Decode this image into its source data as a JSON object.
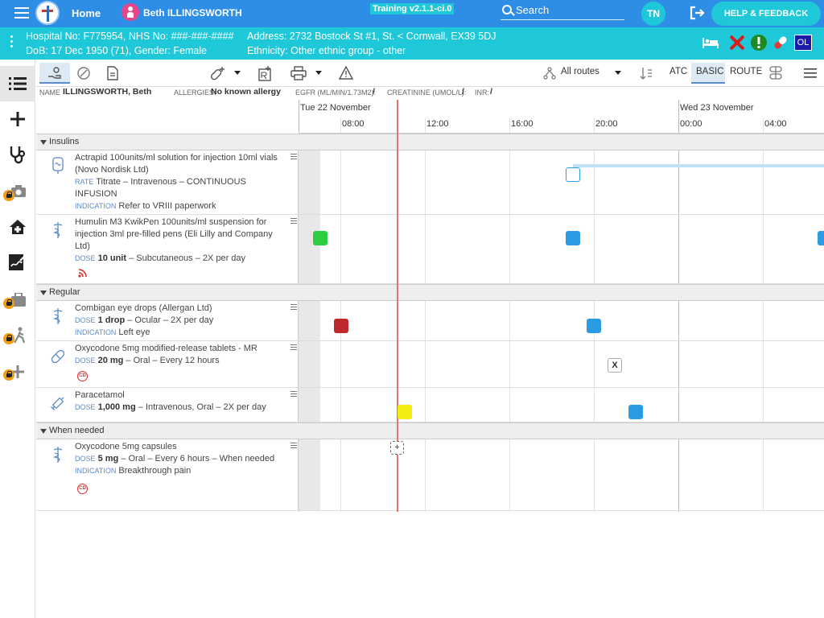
{
  "topbar": {
    "home_label": "Home",
    "patient_name": "Beth ILLINGSWORTH",
    "training_badge": "Training v2.1.1-ci.0",
    "search_label": "Search",
    "user_initials": "TN",
    "help_label": "HELP & FEEDBACK"
  },
  "patient": {
    "hospital_line": "Hospital No: F775954, NHS No: ###-###-####",
    "dob_line": "DoB: 17 Dec 1950 (71), Gender: Female",
    "address_line": "Address: 2732 Bostock St #1, St. < Cornwall, EX39 5DJ",
    "ethnicity_line": "Ethnicity: Other ethnic group - other",
    "ol_badge": "OL"
  },
  "toolbar": {
    "routes_label": "All routes",
    "atc_label": "ATC",
    "basic_label": "BASIC",
    "route_label": "ROUTE"
  },
  "infobar": {
    "name_key": "NAME",
    "name_value": "ILLINGSWORTH, Beth",
    "allergies_key": "ALLERGIES:",
    "allergies_value": "No known allergy",
    "egfr_key": "EGFR (ML/MIN/1.73M2):",
    "egfr_value": "/",
    "creatinine_key": "CREATININE (UMOL/L):",
    "creatinine_value": "/",
    "inr_key": "INR:",
    "inr_value": "/"
  },
  "timeline": {
    "day1": "Tue 22 November",
    "day2": "Wed 23 November",
    "ticks": [
      "08:00",
      "12:00",
      "16:00",
      "20:00",
      "00:00",
      "04:00"
    ]
  },
  "sections": {
    "insulins": "Insulins",
    "regular": "Regular",
    "when_needed": "When needed"
  },
  "meds": [
    {
      "name": "Actrapid 100units/ml solution for injection 10ml vials (Novo Nordisk Ltd)",
      "k1": "RATE",
      "v1": "Titrate – Intravenous – CONTINUOUS INFUSION",
      "k2": "INDICATION",
      "v2": "Refer to VRIII paperwork"
    },
    {
      "name": "Humulin M3 KwikPen 100units/ml suspension for injection 3ml pre-filled pens (Eli Lilly and Company Ltd)",
      "k1": "DOSE",
      "b1": "10 unit",
      "v1": " – Subcutaneous – 2X per day"
    },
    {
      "name": "Combigan eye drops (Allergan Ltd)",
      "k1": "DOSE",
      "b1": "1 drop",
      "v1": " – Ocular – 2X per day",
      "k2": "INDICATION",
      "v2": "Left eye"
    },
    {
      "name": "Oxycodone 5mg modified-release tablets - MR",
      "k1": "DOSE",
      "b1": "20 mg",
      "v1": " – Oral – Every 12 hours",
      "cd": "CD"
    },
    {
      "name": "Paracetamol",
      "k1": "DOSE",
      "b1": "1,000 mg",
      "v1": " – Intravenous, Oral – 2X per day"
    },
    {
      "name": "Oxycodone 5mg capsules",
      "k1": "DOSE",
      "b1": "5 mg",
      "v1": " – Oral – Every 6 hours – When needed",
      "k2": "INDICATION",
      "v2": "Breakthrough pain",
      "cd": "CD"
    }
  ],
  "markers": {
    "missed_label": "X",
    "prn_add_label": "+"
  },
  "colors": {
    "topbar": "#2e8ee6",
    "patient_bar": "#1ec8d8",
    "given": "#2ecc40",
    "scheduled": "#2b9be4",
    "overdue": "#c0292b",
    "due_now": "#f5ed12",
    "now_line": "#e57373"
  },
  "icons": [
    "menu-icon",
    "search-icon",
    "logout-icon",
    "bed-icon",
    "cross-icon",
    "alert-icon",
    "pill-icon",
    "list-icon",
    "plus-icon",
    "stethoscope-icon",
    "camera-icon",
    "house-icon",
    "signature-icon",
    "briefcase-icon",
    "walk-icon",
    "lock-icon"
  ]
}
